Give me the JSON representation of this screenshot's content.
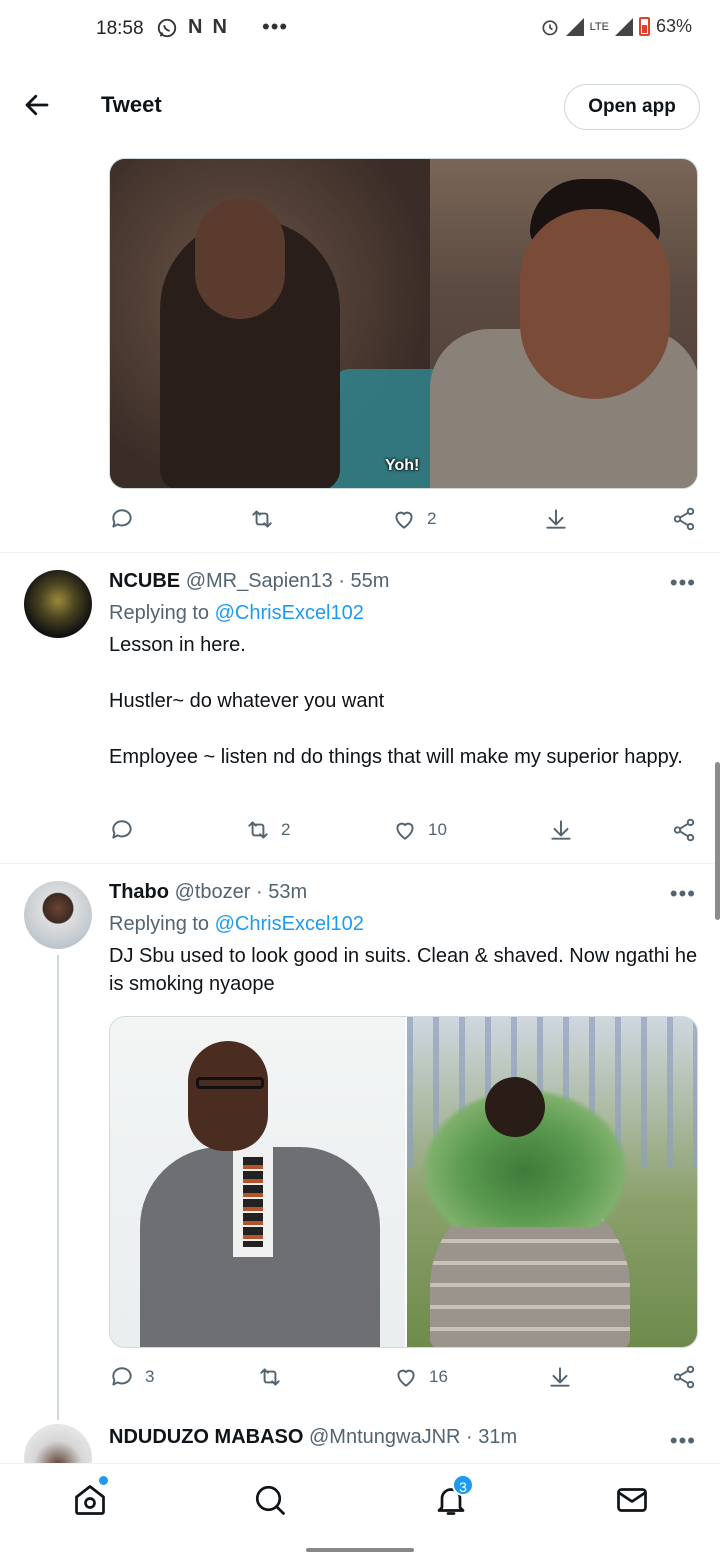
{
  "status_bar": {
    "time": "18:58",
    "notif_icons": [
      "whatsapp-icon",
      "n-icon",
      "n-icon"
    ],
    "network": "LTE",
    "battery": "63%"
  },
  "header": {
    "title": "Tweet",
    "open_app": "Open app"
  },
  "top_tweet": {
    "media_caption": "Yoh!",
    "likes": "2"
  },
  "replies": [
    {
      "name": "NCUBE",
      "handle": "@MR_Sapien13",
      "time": "· 55m",
      "replying_prefix": "Replying to",
      "replying_to": "@ChrisExcel102",
      "text": "Lesson in here.\n\nHustler~ do whatever you want\n\nEmployee ~ listen nd do things that will make my superior happy.",
      "retweets": "2",
      "likes": "10"
    },
    {
      "name": "Thabo",
      "handle": "@tbozer",
      "time": "· 53m",
      "replying_prefix": "Replying to",
      "replying_to": "@ChrisExcel102",
      "text": "DJ Sbu used to look good in suits. Clean & shaved. Now ngathi he is smoking nyaope",
      "replies": "3",
      "likes": "16"
    },
    {
      "name": "NDUDUZO MABASO",
      "handle": "@MntungwaJNR",
      "time": "· 31m"
    }
  ],
  "bottom_nav": {
    "notifications_badge": "3"
  },
  "colors": {
    "accent": "#1d9bf0",
    "secondary_text": "#536471",
    "primary_text": "#0f1419"
  }
}
